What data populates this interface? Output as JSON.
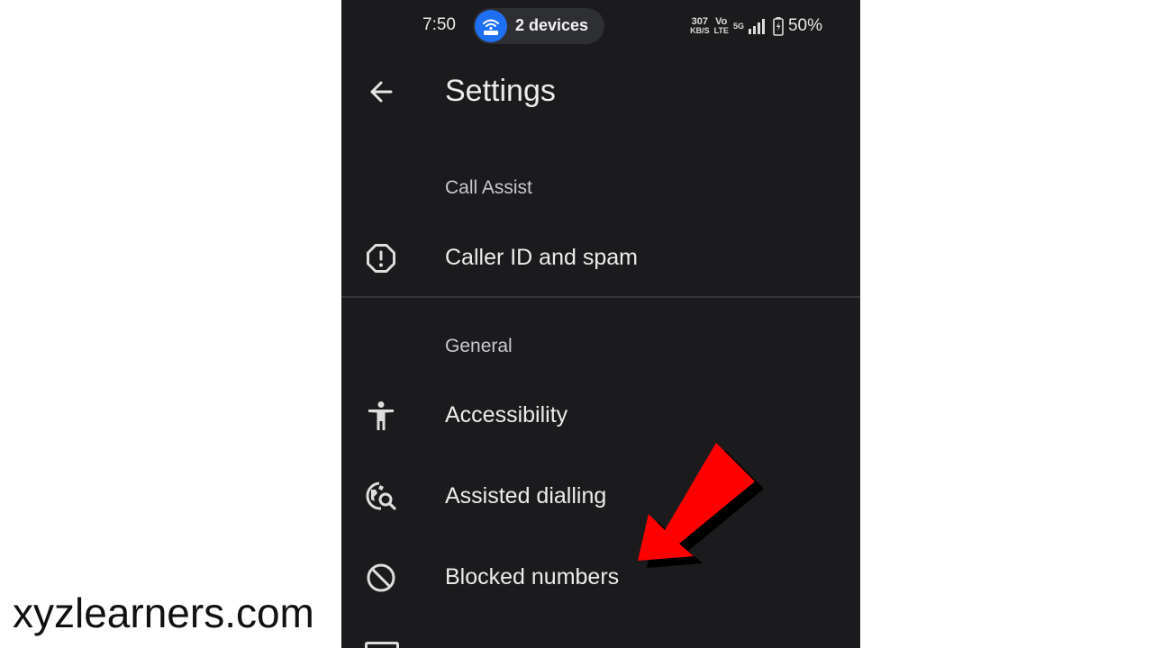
{
  "status_bar": {
    "time": "7:50",
    "hotspot_label": "2 devices",
    "net_speed_value": "307",
    "net_speed_unit": "KB/S",
    "volte_top": "Vo",
    "volte_bottom": "LTE",
    "network_type": "5G",
    "battery": "50%"
  },
  "app_bar": {
    "title": "Settings"
  },
  "sections": {
    "call_assist": {
      "header": "Call Assist",
      "items": [
        {
          "label": "Caller ID and spam",
          "icon": "alert-octagon-icon"
        }
      ]
    },
    "general": {
      "header": "General",
      "items": [
        {
          "label": "Accessibility",
          "icon": "accessibility-icon"
        },
        {
          "label": "Assisted dialling",
          "icon": "globe-search-icon"
        },
        {
          "label": "Blocked numbers",
          "icon": "block-icon"
        }
      ]
    }
  },
  "overlay": {
    "watermark": "xyzlearners.com",
    "arrow_color": "#ff0000"
  },
  "colors": {
    "background": "#1b1b1d",
    "hotspot_accent": "#1f6ff2",
    "text_primary": "#ececec",
    "text_secondary": "#c9c9cc"
  }
}
